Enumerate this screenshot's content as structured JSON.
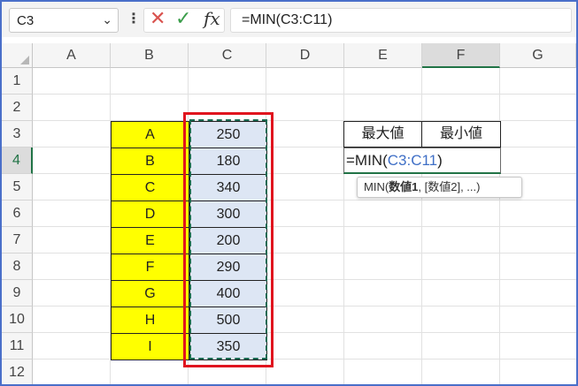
{
  "name_box": {
    "value": "C3",
    "dropdown_icon": "chevron-down-icon"
  },
  "formula_bar": {
    "cancel_icon": "x-icon",
    "enter_icon": "check-icon",
    "function_label": "fx",
    "formula": "=MIN(C3:C11)"
  },
  "columns": [
    "A",
    "B",
    "C",
    "D",
    "E",
    "F",
    "G"
  ],
  "rows": [
    "1",
    "2",
    "3",
    "4",
    "5",
    "6",
    "7",
    "8",
    "9",
    "10",
    "11",
    "12"
  ],
  "labels": [
    "A",
    "B",
    "C",
    "D",
    "E",
    "F",
    "G",
    "H",
    "I"
  ],
  "values": [
    "250",
    "180",
    "340",
    "300",
    "200",
    "290",
    "400",
    "500",
    "350"
  ],
  "headers": {
    "max": "最大値",
    "min": "最小値"
  },
  "editing_cell": {
    "prefix": "=MIN(",
    "ref": "C3:C11",
    "suffix": ")"
  },
  "tooltip": {
    "func": "MIN(",
    "arg1": "数値1",
    "rest": ", [数値2], ...)"
  },
  "colors": {
    "label_fill": "#ffff00",
    "value_fill": "#dde6f4",
    "highlight_border": "#e0141e",
    "accent": "#217346",
    "ref_color": "#3f6fc6"
  }
}
